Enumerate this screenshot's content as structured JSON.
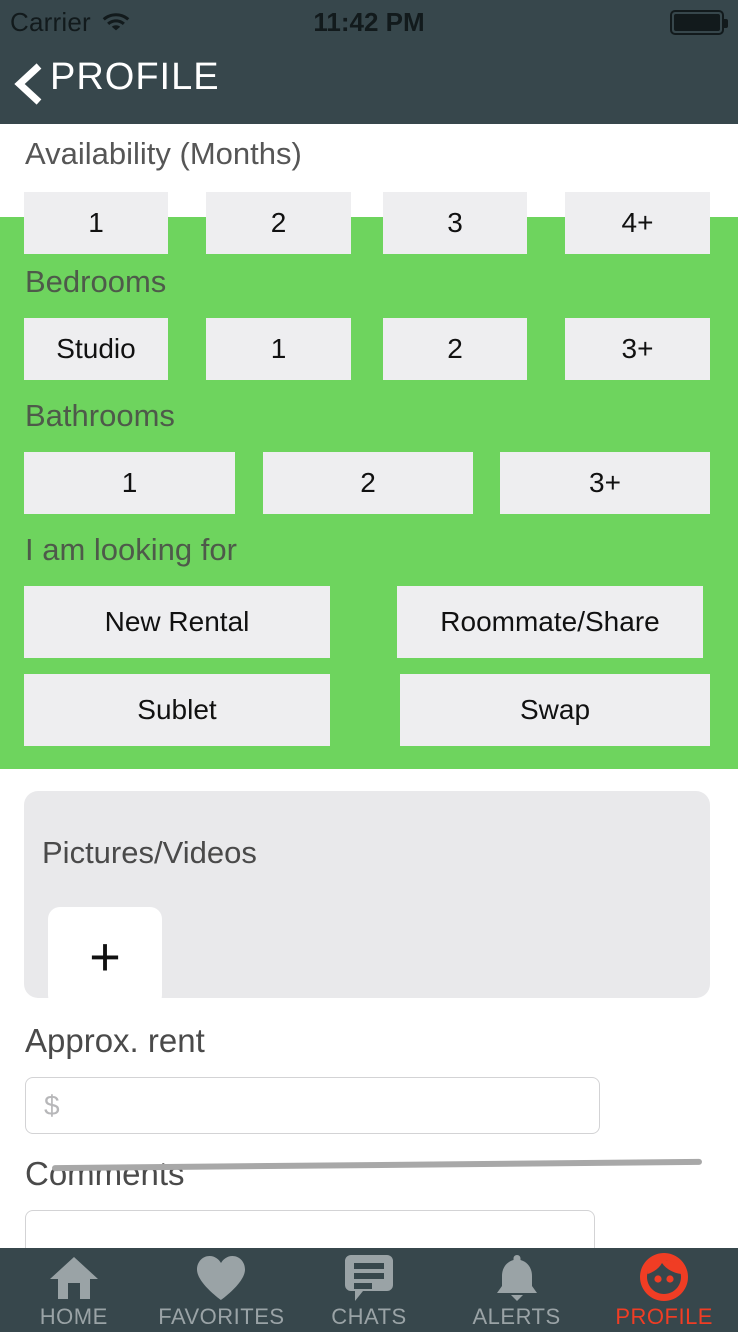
{
  "status_bar": {
    "carrier": "Carrier",
    "wifi_icon": "wifi-icon",
    "time": "11:42 PM",
    "battery_icon": "battery-full-icon"
  },
  "nav": {
    "back_icon": "chevron-left-icon",
    "title": "PROFILE"
  },
  "colors": {
    "nav_background": "#37474c",
    "panel_green": "#6ed45e",
    "option_button": "#eeeef0",
    "active_tab": "#f03d24",
    "inactive_tab": "#9aa3a6"
  },
  "form": {
    "availability": {
      "label": "Availability (Months)",
      "options": [
        "1",
        "2",
        "3",
        "4+"
      ]
    },
    "bedrooms": {
      "label": "Bedrooms",
      "options": [
        "Studio",
        "1",
        "2",
        "3+"
      ]
    },
    "bathrooms": {
      "label": "Bathrooms",
      "options": [
        "1",
        "2",
        "3+"
      ]
    },
    "looking_for": {
      "label": "I am looking for",
      "options": [
        "New Rental",
        "Roommate/Share",
        "Sublet",
        "Swap"
      ]
    },
    "media": {
      "label": "Pictures/Videos",
      "add_button_glyph": "+"
    },
    "rent": {
      "label": "Approx. rent",
      "value": "",
      "placeholder": "$"
    },
    "comments": {
      "label": "Comments",
      "value": "",
      "placeholder": ""
    }
  },
  "tab_bar": {
    "items": [
      {
        "label": "HOME",
        "icon": "home-icon",
        "active": false
      },
      {
        "label": "FAVORITES",
        "icon": "heart-icon",
        "active": false
      },
      {
        "label": "CHATS",
        "icon": "chat-bubble-icon",
        "active": false
      },
      {
        "label": "ALERTS",
        "icon": "bell-icon",
        "active": false
      },
      {
        "label": "PROFILE",
        "icon": "person-face-icon",
        "active": true
      }
    ]
  }
}
